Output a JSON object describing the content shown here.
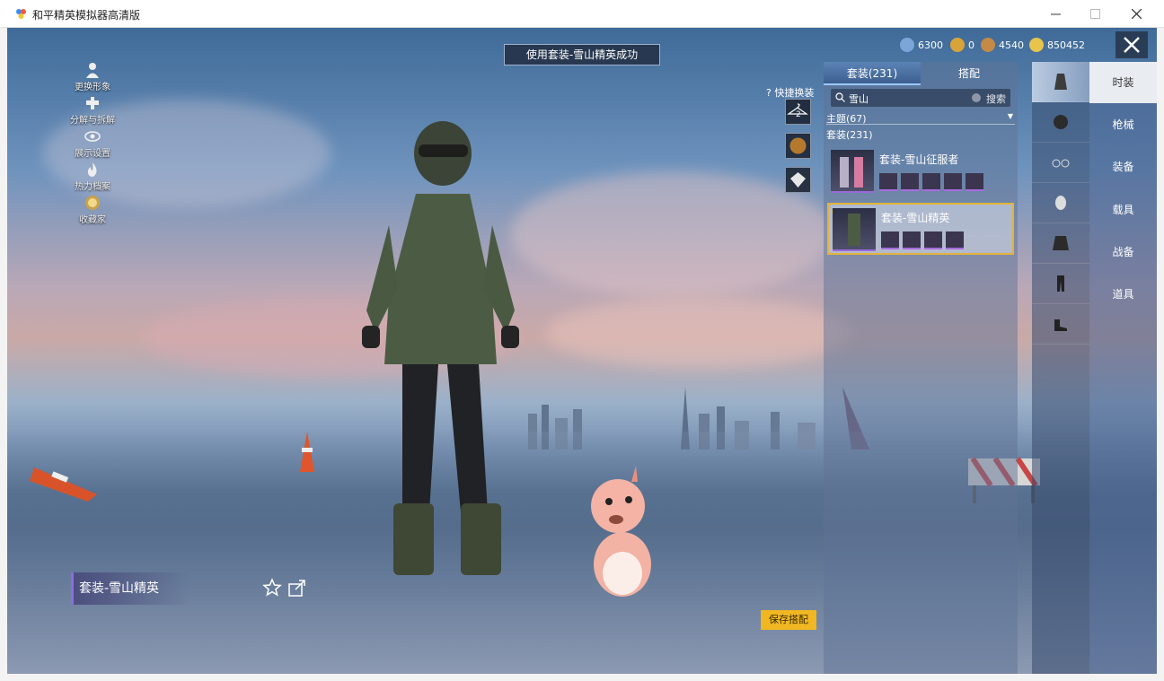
{
  "window": {
    "title": "和平精英模拟器高清版"
  },
  "toast": "使用套装-雪山精英成功",
  "currencies": [
    {
      "icon": "coin-blue-icon",
      "value": "6300",
      "color": "#7aa6d8"
    },
    {
      "icon": "coin-gold-icon",
      "value": "0",
      "color": "#d8a43a"
    },
    {
      "icon": "coin-bronze-icon",
      "value": "4540",
      "color": "#c58a45"
    },
    {
      "icon": "coin-yellow-icon",
      "value": "850452",
      "color": "#e7c44c"
    }
  ],
  "left_menu": [
    {
      "icon": "person-icon",
      "label": "更换形象"
    },
    {
      "icon": "puzzle-icon",
      "label": "分解与拆解"
    },
    {
      "icon": "eye-icon",
      "label": "展示设置"
    },
    {
      "icon": "flame-icon",
      "label": "热力档案"
    },
    {
      "icon": "badge-icon",
      "label": "收藏家"
    }
  ],
  "quick_change": {
    "label": "快捷换装",
    "slot_number": "2"
  },
  "panel": {
    "tabs": [
      {
        "label": "套装(231)",
        "active": true
      },
      {
        "label": "搭配",
        "active": false
      }
    ],
    "search": {
      "value": "雪山",
      "button": "搜索"
    },
    "filter_theme": "主题(67)",
    "filter_suit": "套装(231)",
    "outfits": [
      {
        "name": "套装-雪山征服者",
        "selected": false,
        "parts": 5
      },
      {
        "name": "套装-雪山精英",
        "selected": true,
        "parts": 4
      }
    ]
  },
  "categories": [
    {
      "label": "时装",
      "active": true
    },
    {
      "label": "枪械",
      "active": false
    },
    {
      "label": "装备",
      "active": false
    },
    {
      "label": "载具",
      "active": false
    },
    {
      "label": "战备",
      "active": false
    },
    {
      "label": "道具",
      "active": false
    }
  ],
  "slot_icons": [
    "suit-icon",
    "helmet-icon",
    "glasses-icon",
    "mask-icon",
    "jacket-icon",
    "pants-icon",
    "shoes-icon"
  ],
  "current_outfit": "套装-雪山精英",
  "save_button": "保存搭配",
  "colors": {
    "accent_gold": "#f0b722",
    "tab_active": "#3c5f8f",
    "selected_border": "#e2b33c"
  }
}
